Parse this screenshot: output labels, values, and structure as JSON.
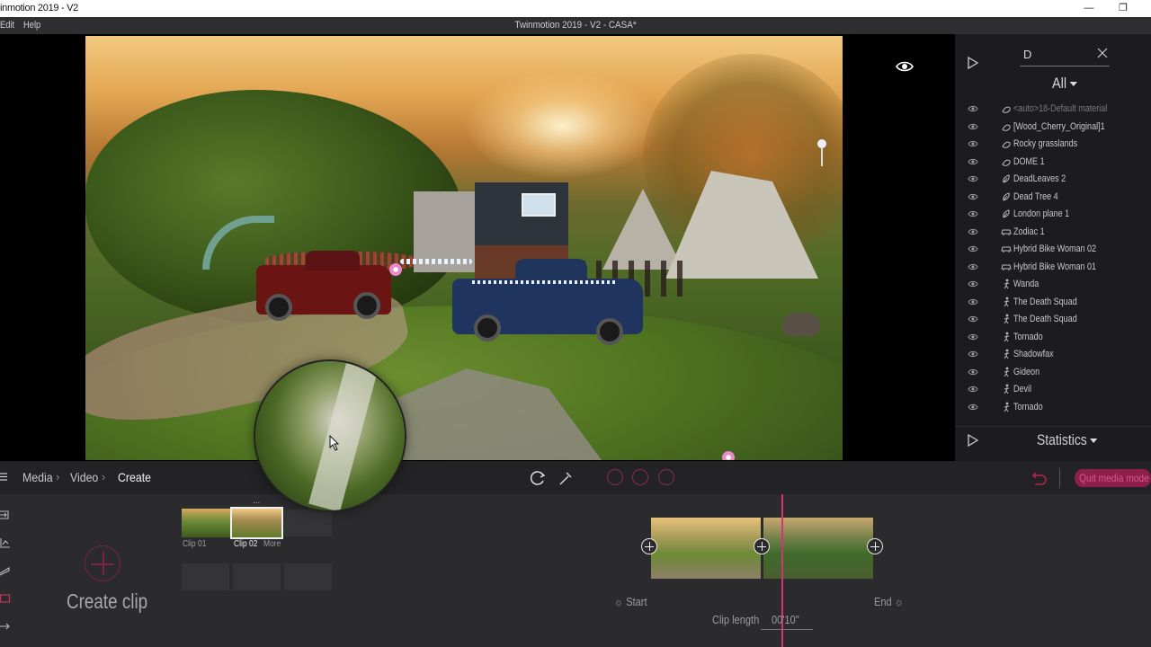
{
  "os": {
    "window_title": "inmotion 2019 - V2",
    "minimize_glyph": "—",
    "restore_glyph": "❐"
  },
  "menu": {
    "items": [
      "Edit",
      "Help"
    ],
    "document_title": "Twinmotion 2019 - V2 - CASA*"
  },
  "right_panel": {
    "search_value": "D",
    "filter_label": "All",
    "items": [
      {
        "label": "<auto>18-Default material",
        "icon": "material-icon",
        "faded": true
      },
      {
        "label": "[Wood_Cherry_Original]1",
        "icon": "material-icon",
        "faded": false
      },
      {
        "label": "Rocky grasslands",
        "icon": "material-icon",
        "faded": false
      },
      {
        "label": "DOME 1",
        "icon": "material-icon",
        "faded": false
      },
      {
        "label": "DeadLeaves 2",
        "icon": "vegetation-icon",
        "faded": false
      },
      {
        "label": "Dead Tree 4",
        "icon": "vegetation-icon",
        "faded": false
      },
      {
        "label": "London plane 1",
        "icon": "vegetation-icon",
        "faded": false
      },
      {
        "label": "Zodiac 1",
        "icon": "vehicle-icon",
        "faded": false
      },
      {
        "label": "Hybrid Bike Woman 02",
        "icon": "vehicle-icon",
        "faded": false
      },
      {
        "label": "Hybrid Bike Woman 01",
        "icon": "vehicle-icon",
        "faded": false
      },
      {
        "label": "Wanda",
        "icon": "character-icon",
        "faded": false
      },
      {
        "label": "The Death Squad",
        "icon": "character-icon",
        "faded": false
      },
      {
        "label": "The Death Squad",
        "icon": "character-icon",
        "faded": false
      },
      {
        "label": "Tornado",
        "icon": "character-icon",
        "faded": false
      },
      {
        "label": "Shadowfax",
        "icon": "character-icon",
        "faded": false
      },
      {
        "label": "Gideon",
        "icon": "character-icon",
        "faded": false
      },
      {
        "label": "Devil",
        "icon": "character-icon",
        "faded": false
      },
      {
        "label": "Tornado",
        "icon": "character-icon",
        "faded": false
      }
    ],
    "statistics_label": "Statistics"
  },
  "bottom_bar": {
    "breadcrumb": [
      "Media",
      "Video",
      "Create"
    ],
    "quit_label": "Quit media mode"
  },
  "bottom_area": {
    "create_clip_label": "Create clip",
    "clips": [
      {
        "label": "Clip 01",
        "selected": false
      },
      {
        "label": "Clip 02",
        "selected": true
      }
    ],
    "more_label": "More",
    "timeline": {
      "start_label": "☼ Start",
      "end_label": "End ☼",
      "clip_length_label": "Clip length",
      "clip_length_value": "00'10\""
    }
  },
  "colors": {
    "accent": "#d6336f",
    "panel_bg": "#1c1c1e",
    "toolbar_bg": "#232325",
    "bottom_bg": "#2b2b2d"
  }
}
